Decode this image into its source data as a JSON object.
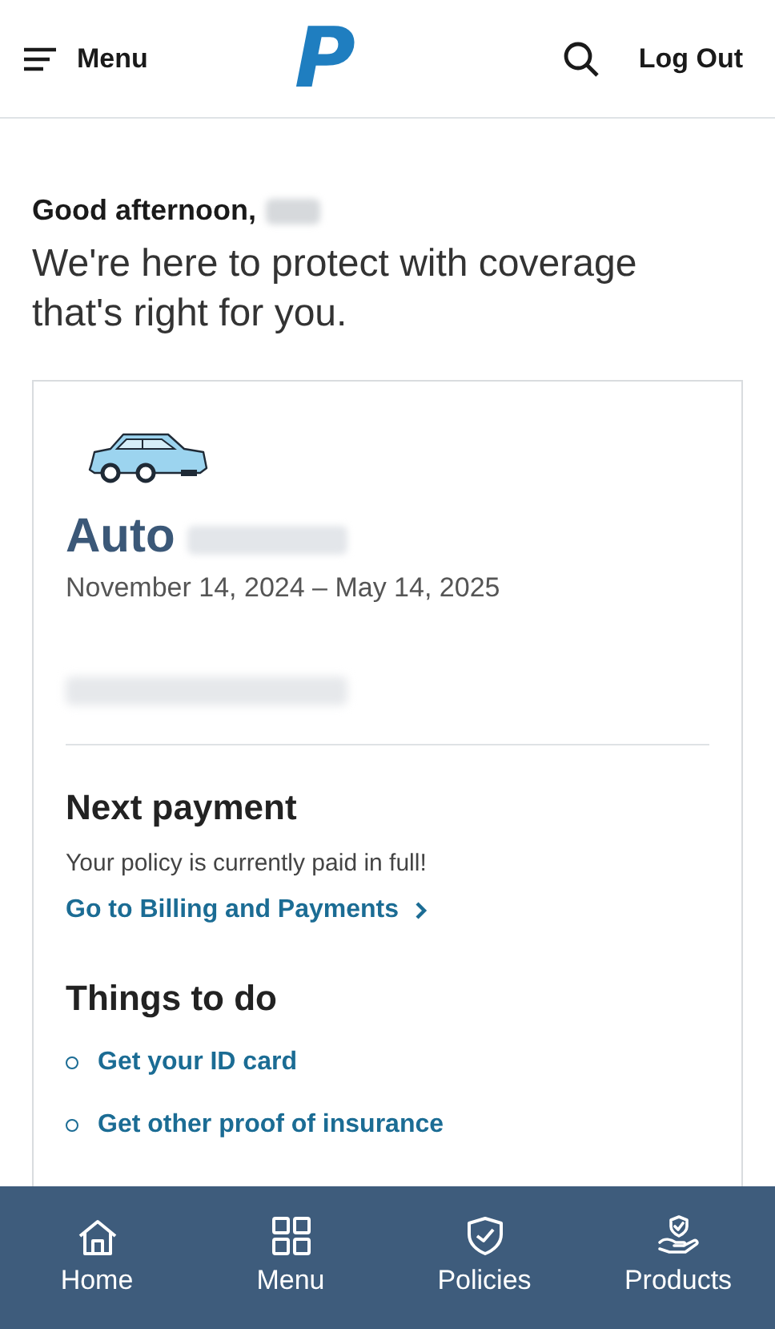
{
  "header": {
    "menu_label": "Menu",
    "logo": "P",
    "logout_label": "Log Out"
  },
  "greeting": {
    "title": "Good afternoon,",
    "subtitle": "We're here to protect with coverage that's right for you."
  },
  "policy_card": {
    "type": "Auto",
    "dates": "November 14, 2024 – May 14, 2025",
    "next_payment": {
      "heading": "Next payment",
      "message": "Your policy is currently paid in full!",
      "link": "Go to Billing and Payments"
    },
    "things_to_do": {
      "heading": "Things to do",
      "items": [
        "Get your ID card",
        "Get other proof of insurance"
      ]
    }
  },
  "bottom_nav": [
    {
      "label": "Home"
    },
    {
      "label": "Menu"
    },
    {
      "label": "Policies"
    },
    {
      "label": "Products"
    }
  ]
}
